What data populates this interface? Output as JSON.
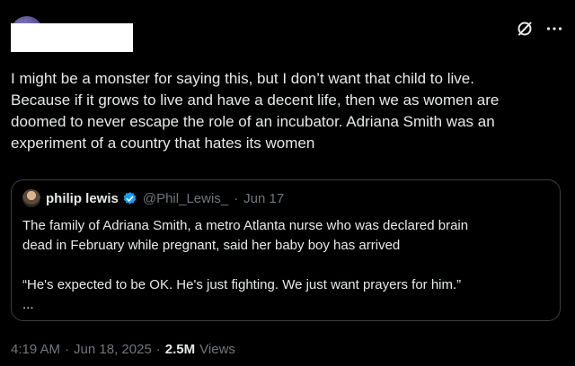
{
  "tweet": {
    "text_lines": [
      "I might be a monster for saying this, but I don’t want that child to live.",
      "Because if it grows to live and have a decent life, then we as women are",
      "doomed to never escape the role of an incubator. Adriana Smith was an",
      "experiment of a country that hates its women"
    ],
    "time": "4:19 AM",
    "date": "Jun 18, 2025",
    "separator": "·",
    "views_count": "2.5M",
    "views_label": "Views"
  },
  "quoted": {
    "name": "philip lewis",
    "handle": "@Phil_Lewis_",
    "separator": "·",
    "date": "Jun 17",
    "lines": [
      "The family of Adriana Smith, a metro Atlanta nurse who was declared brain",
      "dead in February while pregnant, said her baby boy has arrived",
      "“He's expected to be OK. He's just fighting. We just want prayers for him.”",
      "..."
    ]
  },
  "icons": {
    "grok": "grok-icon",
    "more": "more-options-icon",
    "verified": "verified-badge-icon"
  },
  "colors": {
    "background": "#000000",
    "text": "#e7e9ea",
    "muted": "#71767b",
    "verified": "#1d9bf0",
    "quote_border": "#3a3f44"
  }
}
